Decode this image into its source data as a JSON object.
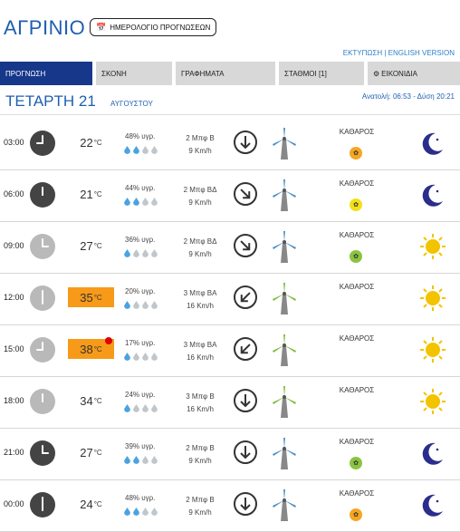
{
  "header": {
    "city": "ΑΓΡΙΝΙΟ",
    "calendar_button": "ΗΜΕΡΟΛΟΓΙΟ ΠΡΟΓΝΩΣΕΩΝ",
    "print_link": "ΕΚΤΥΠΩΣΗ",
    "separator": " | ",
    "english_link": "ENGLISH VERSION"
  },
  "tabs": [
    "ΠΡΟΓΝΩΣΗ",
    "ΣΚΟΝΗ",
    "ΓΡΑΦΗΜΑΤΑ",
    "ΣΤΑΘΜΟΙ [1]",
    "ΕΙΚΟΝΙΔΙΑ"
  ],
  "date": {
    "day": "ΤΕΤΑΡΤΗ 21",
    "month": "ΑΥΓΟΥΣΤΟΥ",
    "sun": "Ανατολή: 06:53 - Δύση 20:21"
  },
  "forecast": [
    {
      "time": "03:00",
      "temp": "22",
      "unit": "°C",
      "hum": "48% υγρ.",
      "drops": 2,
      "wind1": "2 Μπφ Β",
      "wind2": "9 Km/h",
      "dir": "down",
      "sky": "ΚΑΘΑΡΟΣ",
      "badge": "orange",
      "icon": "moon-icon"
    },
    {
      "time": "06:00",
      "temp": "21",
      "unit": "°C",
      "hum": "44% υγρ.",
      "drops": 2,
      "wind1": "2 Μπφ ΒΔ",
      "wind2": "9 Km/h",
      "dir": "downright",
      "sky": "ΚΑΘΑΡΟΣ",
      "badge": "yellow",
      "icon": "moon-icon"
    },
    {
      "time": "09:00",
      "temp": "27",
      "unit": "°C",
      "hum": "36% υγρ.",
      "drops": 1,
      "wind1": "2 Μπφ ΒΔ",
      "wind2": "9 Km/h",
      "dir": "downright",
      "sky": "ΚΑΘΑΡΟΣ",
      "badge": "green",
      "icon": "sun-icon"
    },
    {
      "time": "12:00",
      "temp": "35",
      "unit": "°C",
      "hum": "20% υγρ.",
      "drops": 1,
      "wind1": "3 Μπφ ΒΑ",
      "wind2": "16 Km/h",
      "dir": "downleft",
      "sky": "ΚΑΘΑΡΟΣ",
      "badge": "none",
      "icon": "sun-icon",
      "hot": true
    },
    {
      "time": "15:00",
      "temp": "38",
      "unit": "°C",
      "hum": "17% υγρ.",
      "drops": 1,
      "wind1": "3 Μπφ ΒΑ",
      "wind2": "16 Km/h",
      "dir": "downleft",
      "sky": "ΚΑΘΑΡΟΣ",
      "badge": "none",
      "icon": "sun-icon",
      "hot": true,
      "alert": true
    },
    {
      "time": "18:00",
      "temp": "34",
      "unit": "°C",
      "hum": "24% υγρ.",
      "drops": 1,
      "wind1": "3 Μπφ Β",
      "wind2": "16 Km/h",
      "dir": "down",
      "sky": "ΚΑΘΑΡΟΣ",
      "badge": "none",
      "icon": "sun-icon"
    },
    {
      "time": "21:00",
      "temp": "27",
      "unit": "°C",
      "hum": "39% υγρ.",
      "drops": 2,
      "wind1": "2 Μπφ Β",
      "wind2": "9 Km/h",
      "dir": "down",
      "sky": "ΚΑΘΑΡΟΣ",
      "badge": "green",
      "icon": "moon-icon"
    },
    {
      "time": "00:00",
      "temp": "24",
      "unit": "°C",
      "hum": "48% υγρ.",
      "drops": 2,
      "wind1": "2 Μπφ Β",
      "wind2": "9 Km/h",
      "dir": "down",
      "sky": "ΚΑΘΑΡΟΣ",
      "badge": "orange",
      "icon": "moon-icon"
    }
  ],
  "colors": {
    "brand_blue": "#1f5fb0",
    "active_tab": "#17388a",
    "hot_temp": "#f79a19",
    "alert_dot": "#e00000"
  }
}
